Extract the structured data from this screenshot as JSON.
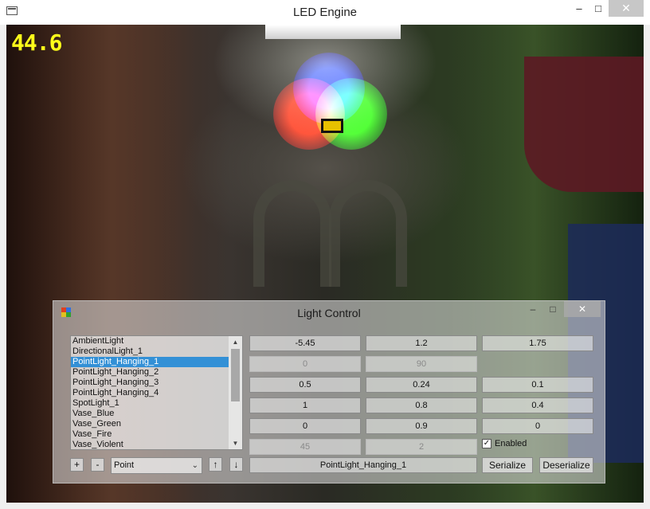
{
  "window": {
    "title": "LED Engine",
    "minimize": "‒",
    "maximize": "□",
    "close": "✕"
  },
  "viewport": {
    "fps": "44.6"
  },
  "dialog": {
    "title": "Light Control",
    "minimize": "‒",
    "maximize": "□",
    "close": "✕",
    "lights": [
      "AmbientLight",
      "DirectionalLight_1",
      "PointLight_Hanging_1",
      "PointLight_Hanging_2",
      "PointLight_Hanging_3",
      "PointLight_Hanging_4",
      "SpotLight_1",
      "Vase_Blue",
      "Vase_Green",
      "Vase_Fire",
      "Vase_Violent"
    ],
    "selected_index": 2,
    "fields": {
      "r1c1": "-5.45",
      "r1c2": "1.2",
      "r1c3": "1.75",
      "r2c1": "0",
      "r2c2": "90",
      "r3c1": "0.5",
      "r3c2": "0.24",
      "r3c3": "0.1",
      "r4c1": "1",
      "r4c2": "0.8",
      "r4c3": "0.4",
      "r5c1": "0",
      "r5c2": "0.9",
      "r5c3": "0",
      "r6c1": "45",
      "r6c2": "2"
    },
    "enabled_label": "Enabled",
    "enabled_checked": "✓",
    "name_field": "PointLight_Hanging_1",
    "add_label": "+",
    "remove_label": "-",
    "type_value": "Point",
    "up_label": "↑",
    "down_label": "↓",
    "serialize_label": "Serialize",
    "deserialize_label": "Deserialize"
  }
}
